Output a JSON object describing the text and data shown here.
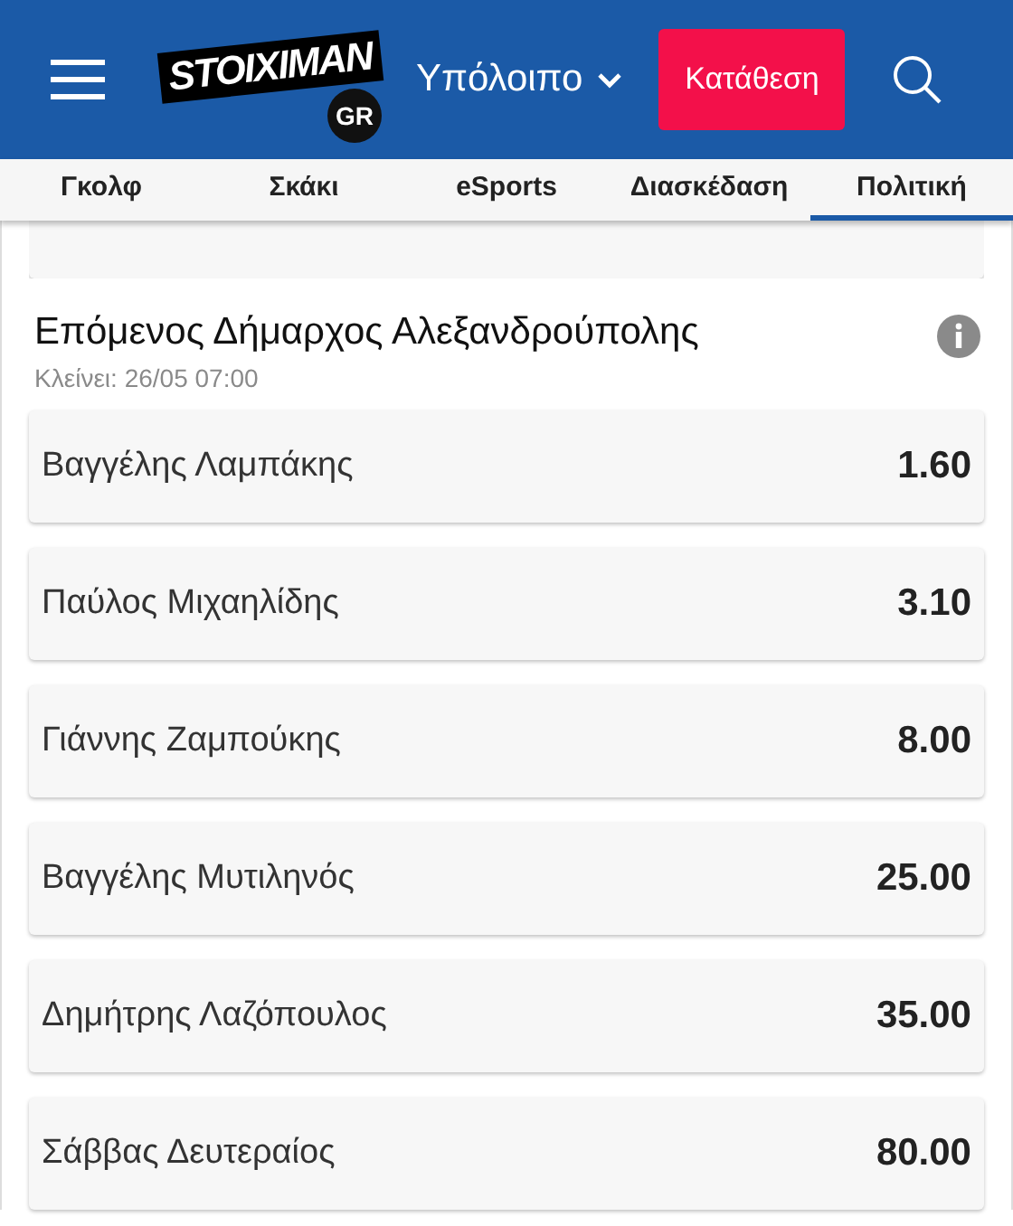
{
  "header": {
    "logo": {
      "wordmark": "STOIXIMAN",
      "region": "GR"
    },
    "balance": "Υπόλοιπο",
    "deposit_button": "Κατάθεση"
  },
  "tabs": [
    {
      "label": "Γκολφ",
      "selected": false
    },
    {
      "label": "Σκάκι",
      "selected": false
    },
    {
      "label": "eSports",
      "selected": false
    },
    {
      "label": "Διασκέδαση",
      "selected": false
    },
    {
      "label": "Πολιτική",
      "selected": true
    }
  ],
  "market": {
    "title": "Επόμενος Δήμαρχος Αλεξανδρούπολης",
    "closes": "Κλείνει: 26/05 07:00",
    "selections": [
      {
        "name": "Βαγγέλης Λαμπάκης",
        "odds": "1.60"
      },
      {
        "name": "Παύλος Μιχαηλίδης",
        "odds": "3.10"
      },
      {
        "name": "Γιάννης Ζαμπούκης",
        "odds": "8.00"
      },
      {
        "name": "Βαγγέλης Μυτιληνός",
        "odds": "25.00"
      },
      {
        "name": "Δημήτρης Λαζόπουλος",
        "odds": "35.00"
      },
      {
        "name": "Σάββας Δευτεραίος",
        "odds": "80.00"
      }
    ]
  }
}
